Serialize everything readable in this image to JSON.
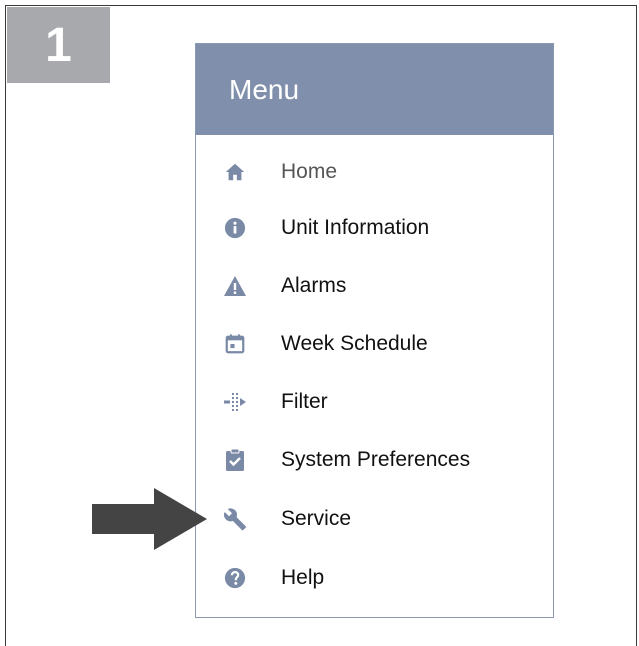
{
  "step": {
    "number": "1"
  },
  "menu": {
    "title": "Menu",
    "items": [
      {
        "label": "Home",
        "icon": "home-icon"
      },
      {
        "label": "Unit Information",
        "icon": "info-icon"
      },
      {
        "label": "Alarms",
        "icon": "warning-icon"
      },
      {
        "label": "Week Schedule",
        "icon": "calendar-icon"
      },
      {
        "label": "Filter",
        "icon": "filter-icon"
      },
      {
        "label": "System Preferences",
        "icon": "clipboard-check-icon"
      },
      {
        "label": "Service",
        "icon": "wrench-icon"
      },
      {
        "label": "Help",
        "icon": "help-icon"
      }
    ]
  },
  "colors": {
    "header_bg": "#8090ac",
    "icon": "#7a8aa6",
    "step_box": "#a7a9ac",
    "arrow": "#444444"
  }
}
